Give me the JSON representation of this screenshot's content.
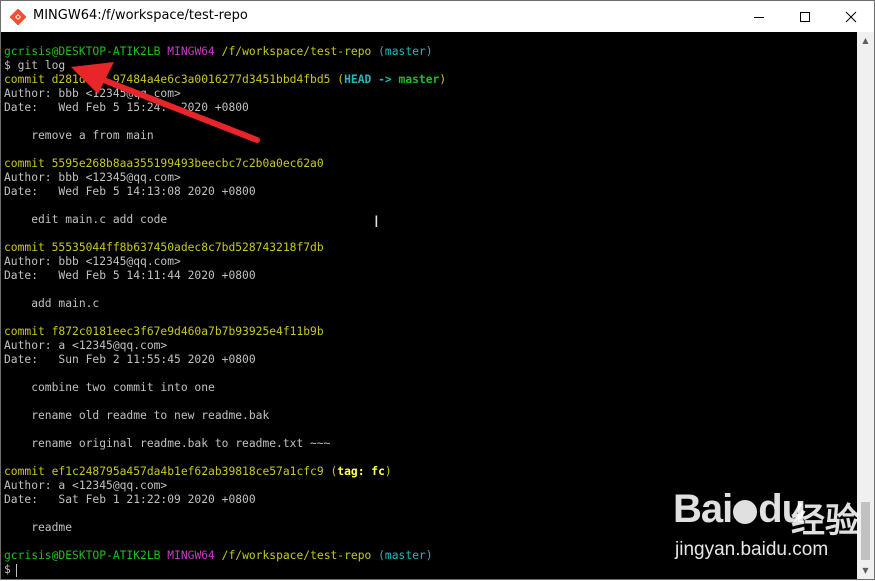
{
  "window": {
    "title": "MINGW64:/f/workspace/test-repo",
    "app_icon": "git-bash-icon",
    "controls": [
      "minimize-icon",
      "maximize-icon",
      "close-icon"
    ]
  },
  "terminal": {
    "prompt": {
      "user_host": "gcrisis@DESKTOP-ATIK2LB",
      "env": "MINGW64",
      "path": "/f/workspace/test-repo",
      "branch": "(master)",
      "symbol": "$"
    },
    "command": "git log",
    "commits": [
      {
        "commit_line": "commit d281d    97484a4e6c3a0016277d3451bbd4fbd5",
        "ref_open": "(",
        "ref": "HEAD -> master",
        "ref_close": ")",
        "author": "Author: bbb <12345@qq.com>",
        "date": "Date:   Wed Feb 5 15:24:  2020 +0800",
        "messages": [
          "    remove a from main"
        ]
      },
      {
        "commit_line": "commit 5595e268b8aa355199493beecbc7c2b0a0ec62a0",
        "author": "Author: bbb <12345@qq.com>",
        "date": "Date:   Wed Feb 5 14:13:08 2020 +0800",
        "messages": [
          "    edit main.c add code"
        ]
      },
      {
        "commit_line": "commit 55535044ff8b637450adec8c7bd528743218f7db",
        "author": "Author: bbb <12345@qq.com>",
        "date": "Date:   Wed Feb 5 14:11:44 2020 +0800",
        "messages": [
          "    add main.c"
        ]
      },
      {
        "commit_line": "commit f872c0181eec3f67e9d460a7b7b93925e4f11b9b",
        "author": "Author: a <12345@qq.com>",
        "date": "Date:   Sun Feb 2 11:55:45 2020 +0800",
        "messages": [
          "    combine two commit into one",
          "    rename old readme to new readme.bak",
          "    rename original readme.bak to readme.txt ~~~"
        ]
      },
      {
        "commit_line": "commit ef1c248795a457da4b1ef62ab39818ce57a1cfc9",
        "ref_open": "(",
        "ref": "tag: fc",
        "ref_close": ")",
        "author": "Author: a <12345@qq.com>",
        "date": "Date:   Sat Feb 1 21:22:09 2020 +0800",
        "messages": [
          "    readme"
        ]
      }
    ],
    "final_prompt_symbol": "$"
  },
  "watermark": {
    "logo_text": "Bai",
    "logo_text2": "du",
    "site_cn": "经验",
    "url": "jingyan.baidu.com"
  },
  "colors": {
    "prompt_user": "#1ec01e",
    "prompt_env": "#c33ec3",
    "prompt_path": "#c8c81e",
    "prompt_branch": "#2ab5b5",
    "commit_hash": "#c8c81e",
    "ref_label": "#2ab5b5",
    "ref_branch": "#1ec01e",
    "annotation_arrow": "#e8262a"
  }
}
